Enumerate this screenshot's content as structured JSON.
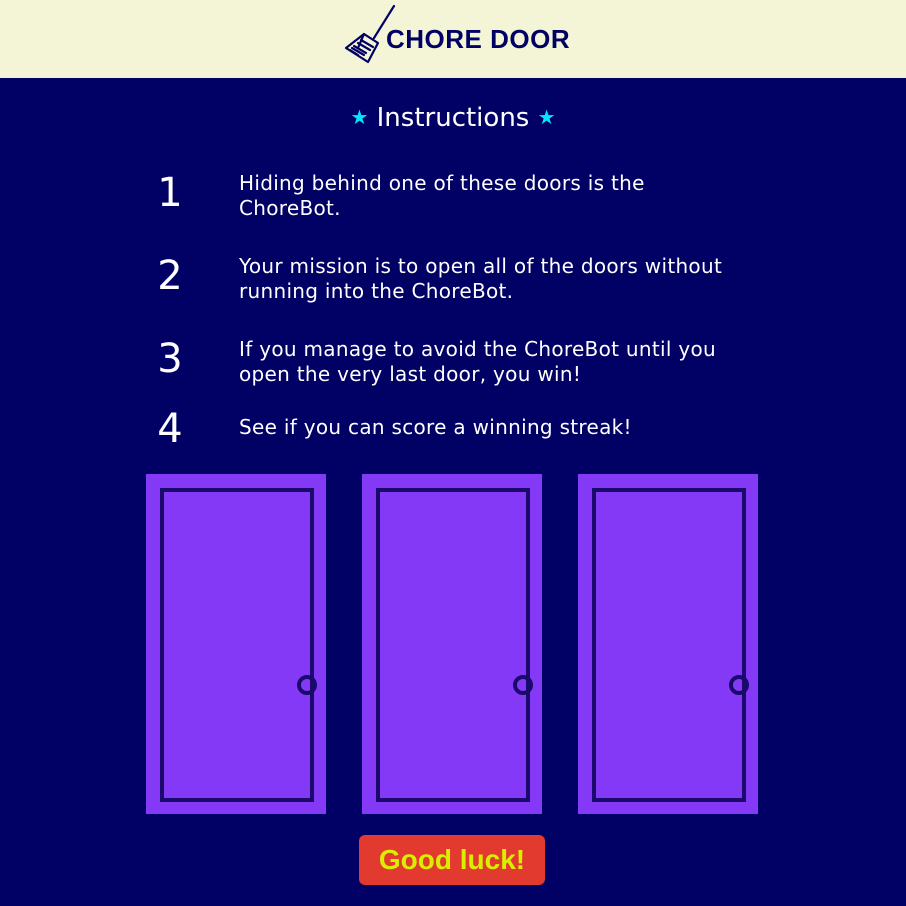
{
  "header": {
    "logo_icon": "broom-icon",
    "brand": "CHORE DOOR"
  },
  "instructions": {
    "title": "Instructions",
    "star_icon": "star-icon",
    "steps": [
      {
        "number": "1",
        "text": "Hiding behind one of these doors is the ChoreBot."
      },
      {
        "number": "2",
        "text": "Your mission is to open all of the doors without running into the ChoreBot."
      },
      {
        "number": "3",
        "text": "If you manage to avoid the ChoreBot until you open the very last door, you win!"
      },
      {
        "number": "4",
        "text": "See if you can score a winning streak!"
      }
    ]
  },
  "doors": {
    "count": 3,
    "icon": "closed-door-icon"
  },
  "start": {
    "label": "Good luck!"
  },
  "colors": {
    "background": "#010165",
    "header_bg": "#f4f4d6",
    "door": "#8439f7",
    "door_outline": "#1a0a6b",
    "star": "#00e6ff",
    "button_bg": "#e23a2e",
    "button_text": "#d8f000"
  }
}
